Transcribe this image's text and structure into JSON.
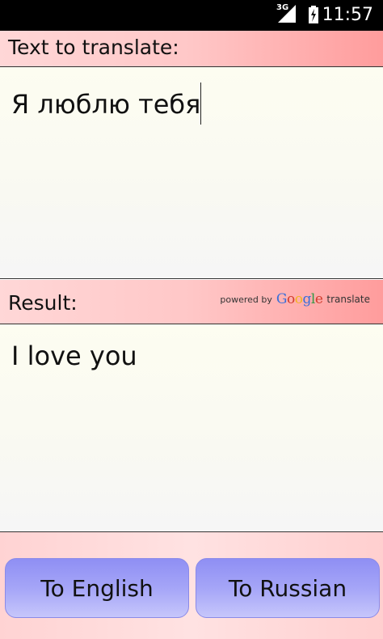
{
  "status_bar": {
    "network": "3G",
    "time": "11:57"
  },
  "input_section": {
    "label": "Text to translate:",
    "text": "Я люблю тебя"
  },
  "result_section": {
    "label": "Result:",
    "powered_by": "powered by",
    "google": [
      "G",
      "o",
      "o",
      "g",
      "l",
      "e"
    ],
    "translate_word": "translate",
    "text": "I love you"
  },
  "buttons": {
    "to_english": "To English",
    "to_russian": "To Russian"
  },
  "colors": {
    "header_gradient_start": "#ffd7d7",
    "header_gradient_end": "#ff9c9c",
    "button_color": "#a5a5f7",
    "status_bar": "#000000"
  },
  "icons": {
    "signal": "signal-icon",
    "battery": "battery-charging-icon"
  }
}
